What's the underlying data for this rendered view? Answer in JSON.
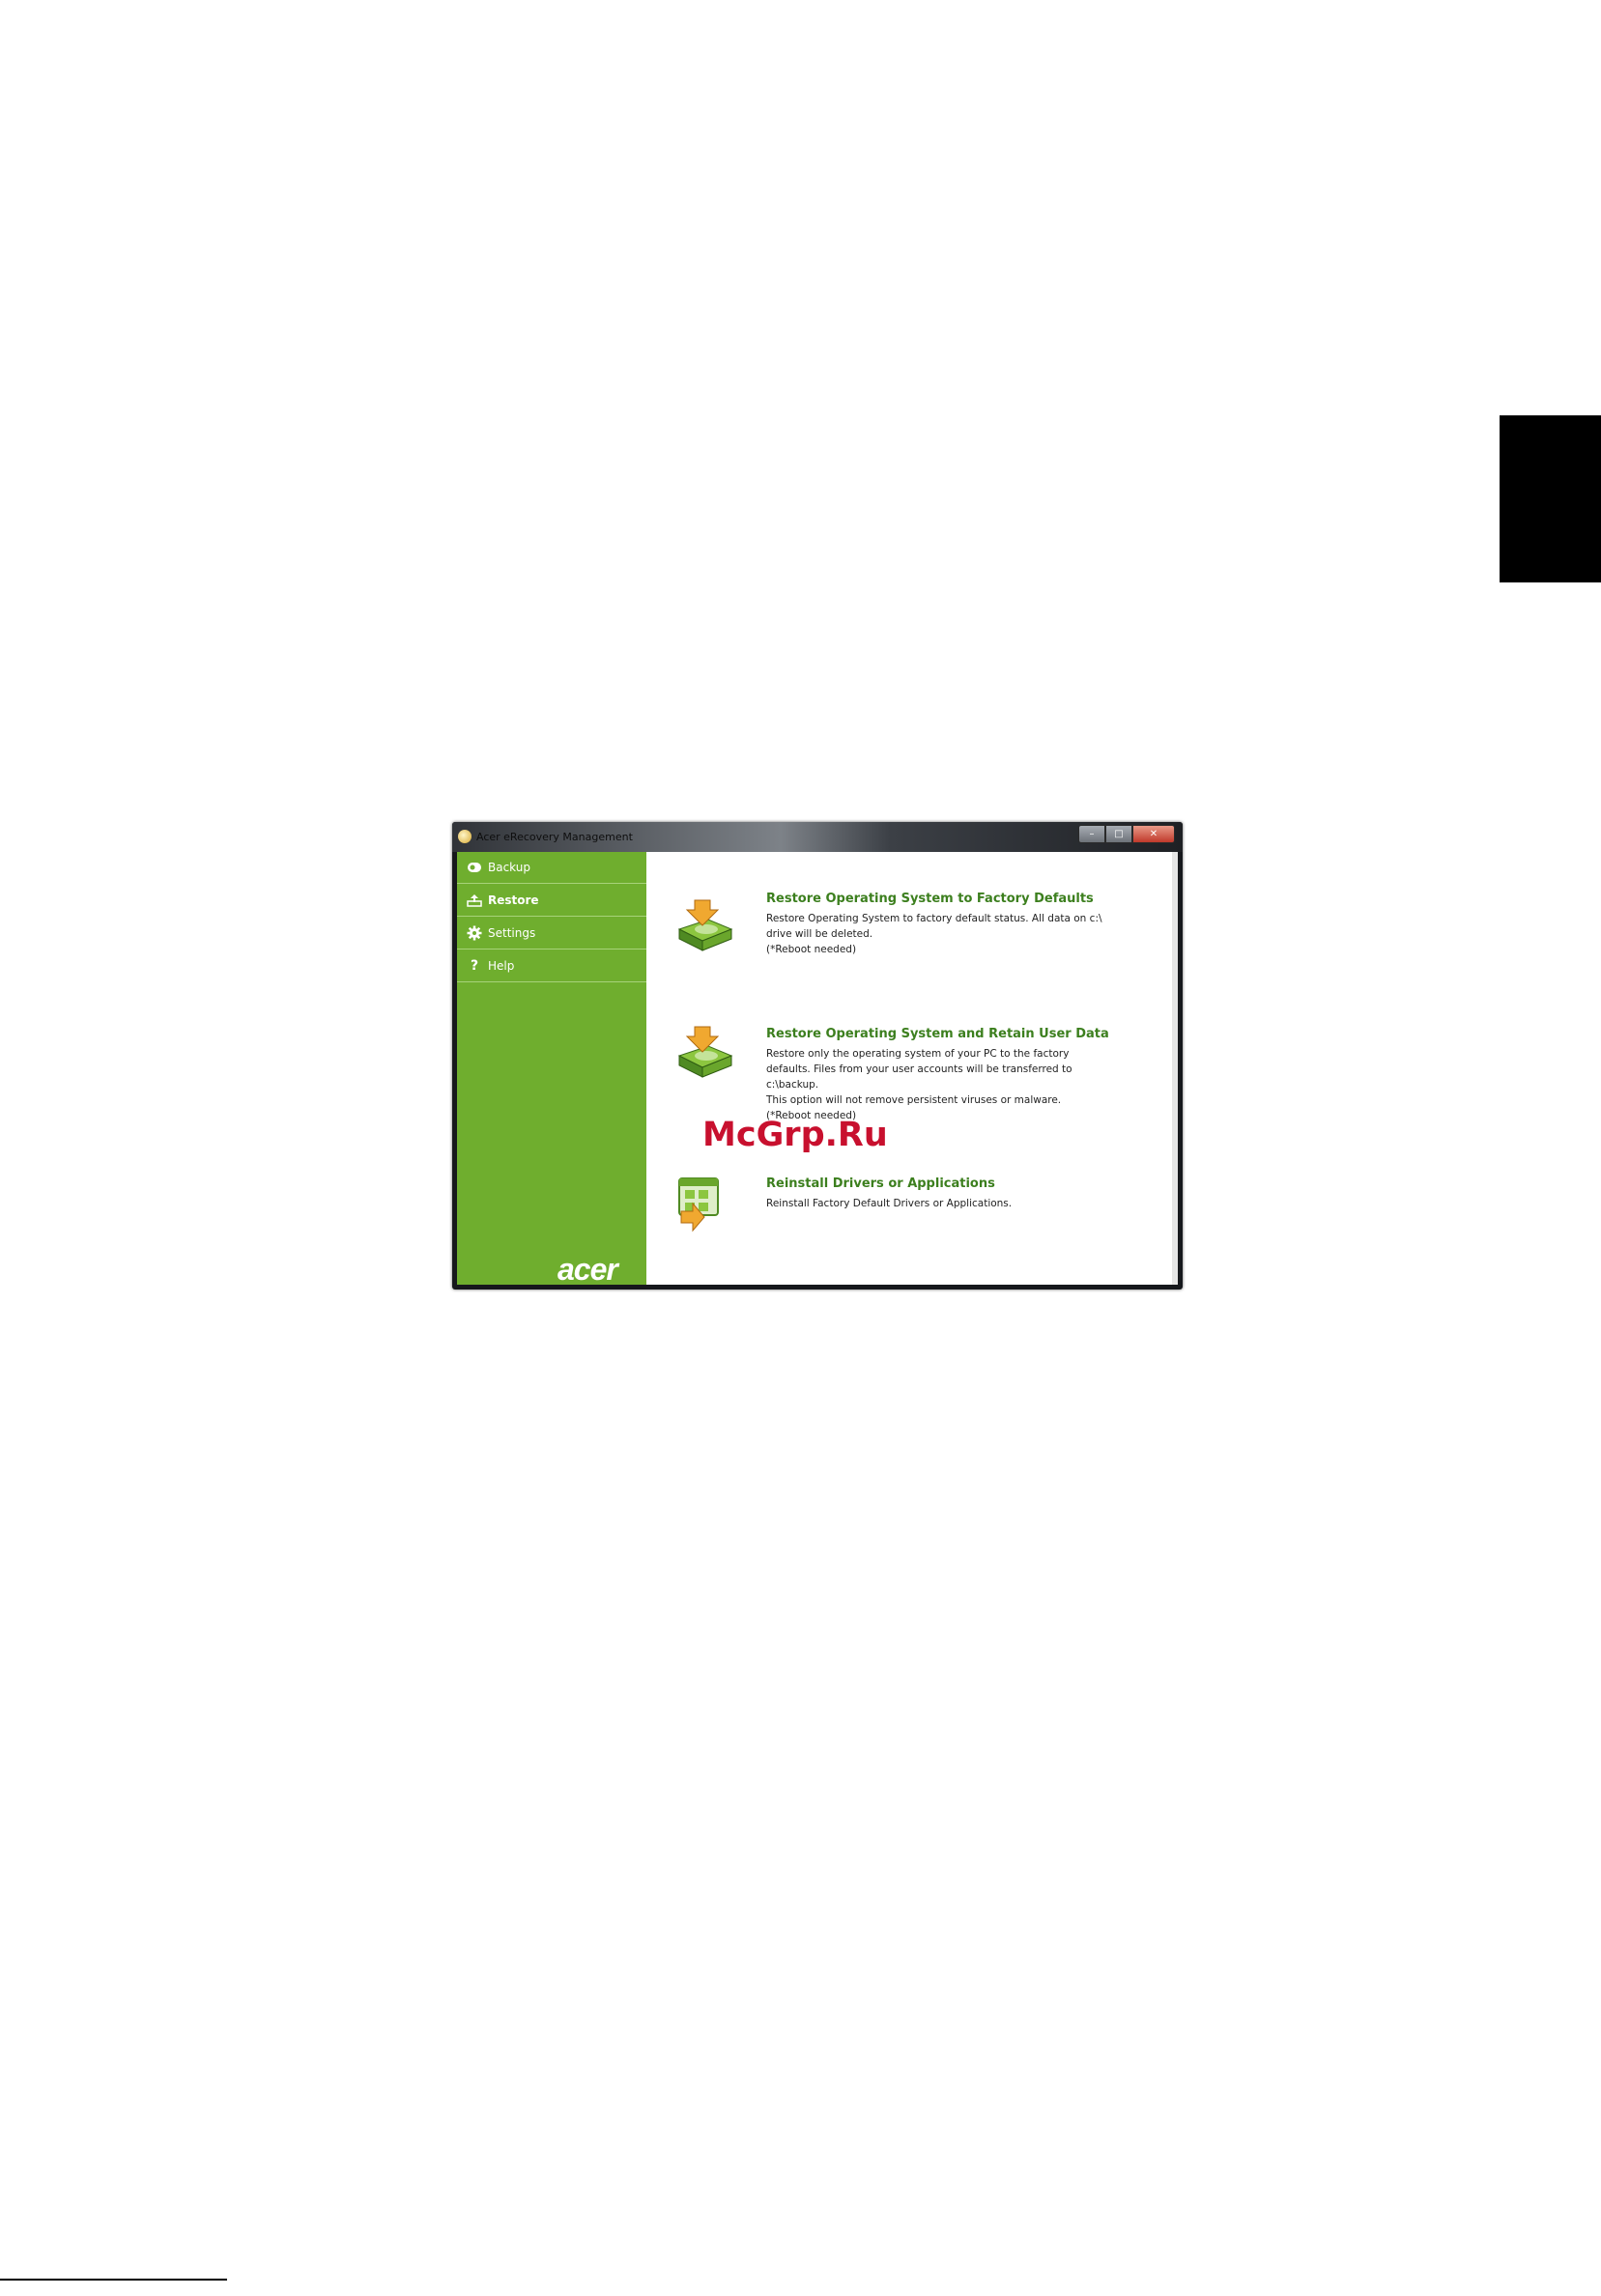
{
  "window": {
    "title": "Acer eRecovery Management",
    "controls": {
      "minimize": "–",
      "maximize": "□",
      "close": "✕"
    }
  },
  "sidebar": {
    "items": [
      {
        "label": "Backup",
        "icon": "backup-icon",
        "selected": false
      },
      {
        "label": "Restore",
        "icon": "restore-icon",
        "selected": true
      },
      {
        "label": "Settings",
        "icon": "gear-icon",
        "selected": false
      },
      {
        "label": "Help",
        "icon": "help-icon",
        "selected": false
      }
    ],
    "brand": "acer"
  },
  "main": {
    "options": [
      {
        "title": "Restore Operating System to Factory Defaults",
        "lines": [
          "Restore Operating System to factory default status. All data on c:\\",
          "drive will be deleted.",
          "(*Reboot needed)"
        ],
        "icon": "restore-drive-icon"
      },
      {
        "title": "Restore Operating System and Retain User Data",
        "lines": [
          "Restore only the operating system of your PC to the factory",
          "defaults. Files from your user accounts will be transferred to",
          "c:\\backup.",
          "This option will not remove persistent viruses or malware.",
          "(*Reboot needed)"
        ],
        "icon": "restore-drive-icon"
      },
      {
        "title": "Reinstall Drivers or Applications",
        "lines": [
          "Reinstall Factory Default Drivers or Applications."
        ],
        "icon": "reinstall-apps-icon"
      }
    ]
  },
  "watermark": "McGrp.Ru",
  "colors": {
    "sidebar": "#6fae2e",
    "title_green": "#3c7f1e",
    "watermark": "#c8102e"
  }
}
